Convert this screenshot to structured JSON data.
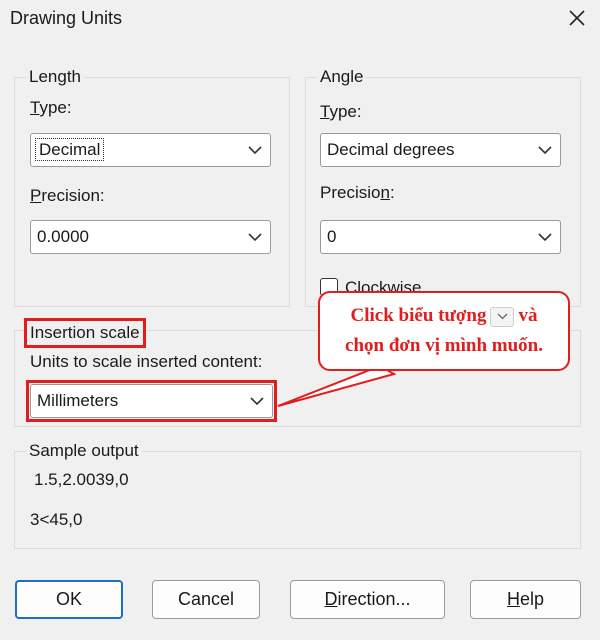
{
  "window": {
    "title": "Drawing Units"
  },
  "length": {
    "legend": "Length",
    "type_label": "Type:",
    "type_value": "Decimal",
    "precision_label": "Precision:",
    "precision_value": "0.0000"
  },
  "angle": {
    "legend": "Angle",
    "type_label": "Type:",
    "type_value": "Decimal degrees",
    "precision_label": "Precision:",
    "precision_value": "0",
    "clockwise_label": "Clockwise",
    "clockwise_checked": false
  },
  "insertion": {
    "legend": "Insertion scale",
    "units_label": "Units to scale inserted content:",
    "units_value": "Millimeters"
  },
  "sample": {
    "legend": "Sample output",
    "line1": "1.5,2.0039,0",
    "line2": "3<45,0"
  },
  "callout": {
    "line1_before": "Click biểu tượng",
    "line1_after": "và",
    "line2": "chọn đơn vị mình muốn."
  },
  "buttons": {
    "ok": "OK",
    "cancel": "Cancel",
    "direction": "Direction...",
    "help": "Help"
  },
  "colors": {
    "annotation_red": "#e21d1d",
    "default_button_border": "#1e6ec8"
  },
  "icons": {
    "close": "close-icon",
    "dropdown": "chevron-down-icon"
  }
}
